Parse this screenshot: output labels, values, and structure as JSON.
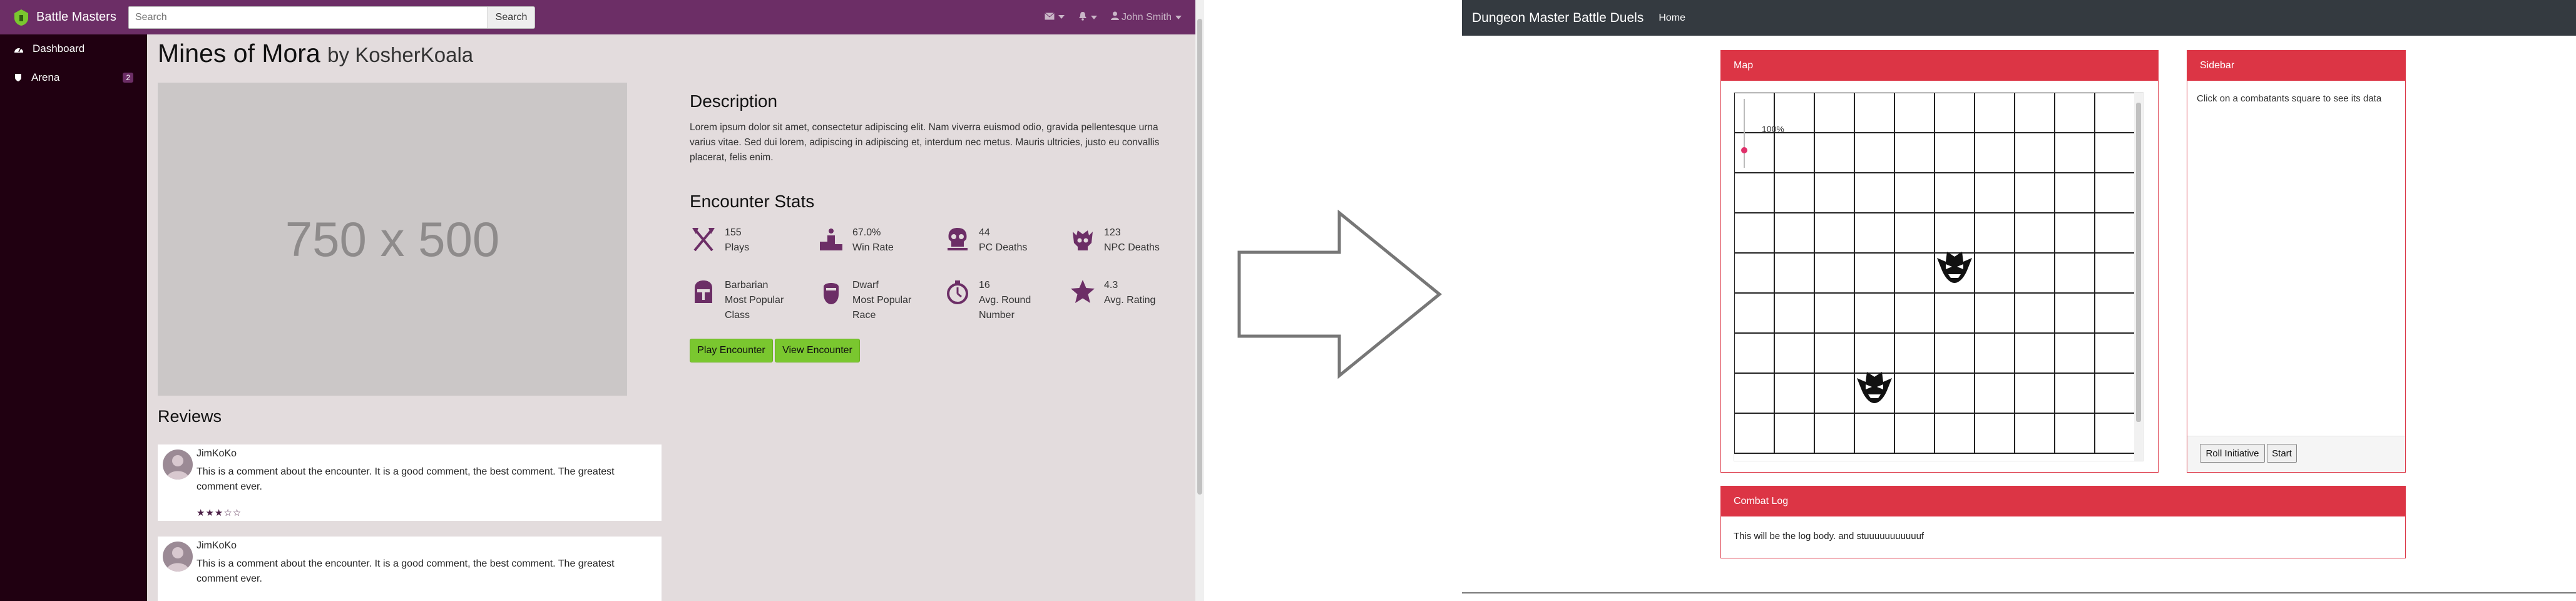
{
  "left_app": {
    "brand": "Battle Masters",
    "search": {
      "placeholder": "Search",
      "value": "",
      "button": "Search"
    },
    "user_name": "John Smith",
    "sidebar": [
      {
        "label": "Dashboard",
        "icon": "dashboard-icon"
      },
      {
        "label": "Arena",
        "icon": "arena-icon",
        "badge": "2"
      }
    ],
    "encounter": {
      "title": "Mines of Mora",
      "by": "by KosherKoala",
      "image_placeholder": "750 x 500",
      "description_heading": "Description",
      "description": "Lorem ipsum dolor sit amet, consectetur adipiscing elit. Nam viverra euismod odio, gravida pellentesque urna varius vitae. Sed dui lorem, adipiscing in adipiscing et, interdum nec metus. Mauris ultricies, justo eu convallis placerat, felis enim.",
      "stats_heading": "Encounter Stats",
      "stats": [
        {
          "value": "155",
          "label": "Plays",
          "icon": "crossed-axes-icon"
        },
        {
          "value": "67.0%",
          "label": "Win Rate",
          "icon": "podium-icon"
        },
        {
          "value": "44",
          "label": "PC Deaths",
          "icon": "skull-icon"
        },
        {
          "value": "123",
          "label": "NPC Deaths",
          "icon": "monster-skull-icon"
        },
        {
          "value": "Barbarian",
          "label": "Most Popular Class",
          "icon": "helmet-icon"
        },
        {
          "value": "Dwarf",
          "label": "Most Popular Race",
          "icon": "dwarf-icon"
        },
        {
          "value": "16",
          "label": "Avg. Round Number",
          "icon": "stopwatch-icon"
        },
        {
          "value": "4.3",
          "label": "Avg. Rating",
          "icon": "star-icon"
        }
      ],
      "play_button": "Play Encounter",
      "view_button": "View Encounter",
      "reviews_heading": "Reviews",
      "reviews": [
        {
          "author": "JimKoKo",
          "comment": "This is a comment about the encounter. It is a good comment, the best comment. The greatest comment ever.",
          "stars": "★★★☆☆"
        },
        {
          "author": "JimKoKo",
          "comment": "This is a comment about the encounter. It is a good comment, the best comment. The greatest comment ever.",
          "stars": "☆☆☆☆☆"
        }
      ]
    }
  },
  "right_app": {
    "brand": "Dungeon Master Battle Duels",
    "nav_home": "Home",
    "map_panel": {
      "title": "Map",
      "zoom": "100%"
    },
    "sidebar_panel": {
      "title": "Sidebar",
      "hint": "Click on a combatants square to see its data",
      "roll_button": "Roll Initiative",
      "start_button": "Start"
    },
    "combat_log": {
      "title": "Combat Log",
      "body": "This will be the log body. and stuuuuuuuuuuuf"
    }
  },
  "colors": {
    "purple": "#6c2e66",
    "dark_sidebar": "#200011",
    "green": "#7ac72f",
    "red": "#dc3545",
    "navbar": "#343a40"
  }
}
